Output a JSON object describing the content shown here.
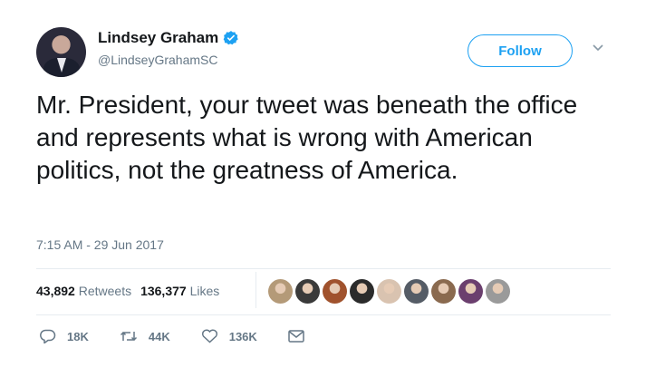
{
  "profile": {
    "name": "Lindsey Graham",
    "handle": "@LindseyGrahamSC",
    "verified": true
  },
  "follow_label": "Follow",
  "tweet": {
    "text": "Mr. President, your tweet was beneath the office and represents what is wrong with American politics, not the greatness of America.",
    "timestamp": "7:15 AM - 29 Jun 2017"
  },
  "stats": {
    "retweets_count": "43,892",
    "retweets_label": "Retweets",
    "likes_count": "136,377",
    "likes_label": "Likes"
  },
  "likers": [
    {
      "icon": "dog-avatar",
      "color": "#b49a78"
    },
    {
      "icon": "person-avatar",
      "color": "#3a3a3a"
    },
    {
      "icon": "person-avatar",
      "color": "#a0522d"
    },
    {
      "icon": "person-avatar",
      "color": "#2b2b2b"
    },
    {
      "icon": "person-avatar",
      "color": "#d9c3b0"
    },
    {
      "icon": "person-avatar",
      "color": "#555c66"
    },
    {
      "icon": "person-avatar",
      "color": "#8a6a4f"
    },
    {
      "icon": "person-avatar",
      "color": "#6b3f6e"
    },
    {
      "icon": "person-avatar",
      "color": "#9a9a9a"
    }
  ],
  "actions": {
    "reply_count": "18K",
    "retweet_count": "44K",
    "like_count": "136K"
  },
  "colors": {
    "accent": "#1da1f2",
    "text_primary": "#14171a",
    "text_secondary": "#657786",
    "divider": "#e6ecf0"
  }
}
